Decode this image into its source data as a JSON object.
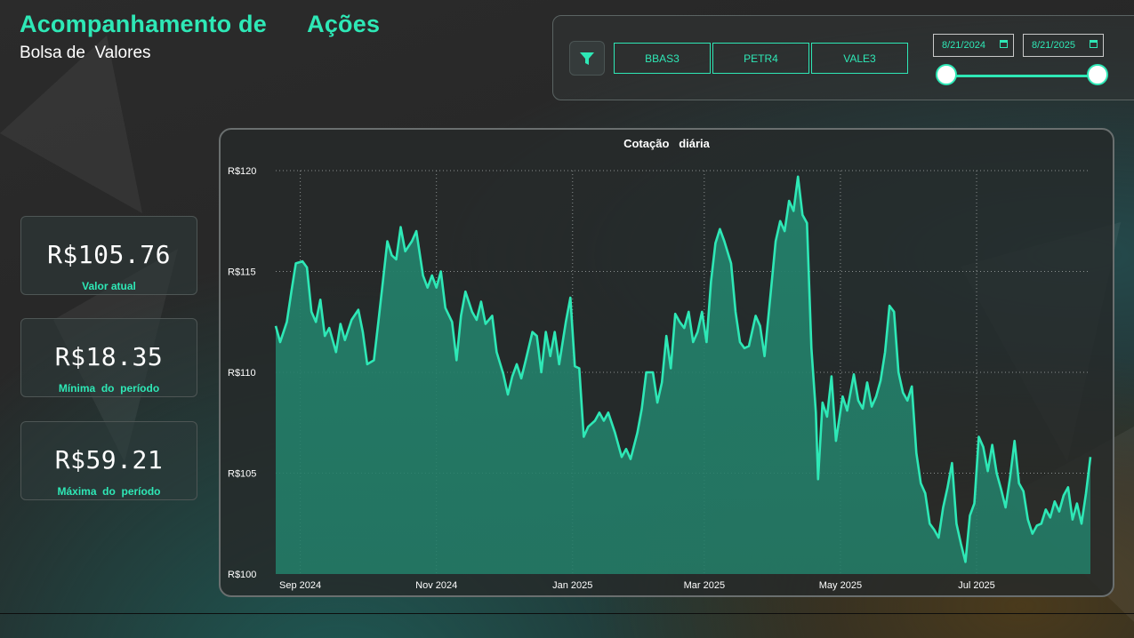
{
  "header": {
    "title": "Acompanhamento de      Ações",
    "subtitle": "Bolsa de  Valores"
  },
  "filters": {
    "icon": "filter-icon",
    "tickers": [
      "BBAS3",
      "PETR4",
      "VALE3"
    ],
    "date_start": "8/21/2024",
    "date_end": "8/21/2025",
    "range_fraction": [
      0,
      1
    ]
  },
  "kpis": [
    {
      "value": "R$105.76",
      "label": "Valor atual"
    },
    {
      "value": "R$18.35",
      "label": "Mínima  do  período"
    },
    {
      "value": "R$59.21",
      "label": "Máxima  do  período"
    }
  ],
  "colors": {
    "accent": "#2ee8b6",
    "area_fill": "#23806a",
    "background": "#262626"
  },
  "chart_data": {
    "type": "area",
    "title": "Cotação   diária",
    "xlabel": "",
    "ylabel": "",
    "ylim": [
      100,
      120
    ],
    "xlim": [
      "2024-08-21",
      "2025-08-21"
    ],
    "y_ticks": [
      "R$100",
      "R$105",
      "R$110",
      "R$115",
      "R$120"
    ],
    "x_ticks": [
      "Sep 2024",
      "Nov 2024",
      "Jan 2025",
      "Mar 2025",
      "May 2025",
      "Jul 2025"
    ],
    "x_tick_dates": [
      "2024-09-01",
      "2024-11-01",
      "2025-01-01",
      "2025-03-01",
      "2025-05-01",
      "2025-07-01"
    ],
    "grid": true,
    "series": [
      {
        "color": "#2ee8b6",
        "points": [
          [
            "2024-08-21",
            112.3
          ],
          [
            "2024-08-23",
            111.5
          ],
          [
            "2024-08-26",
            112.5
          ],
          [
            "2024-08-28",
            114.0
          ],
          [
            "2024-08-30",
            115.4
          ],
          [
            "2024-09-02",
            115.5
          ],
          [
            "2024-09-04",
            115.2
          ],
          [
            "2024-09-06",
            113.0
          ],
          [
            "2024-09-08",
            112.5
          ],
          [
            "2024-09-10",
            113.6
          ],
          [
            "2024-09-12",
            111.8
          ],
          [
            "2024-09-14",
            112.2
          ],
          [
            "2024-09-17",
            111.0
          ],
          [
            "2024-09-19",
            112.4
          ],
          [
            "2024-09-21",
            111.6
          ],
          [
            "2024-09-24",
            112.6
          ],
          [
            "2024-09-27",
            113.1
          ],
          [
            "2024-09-29",
            112.0
          ],
          [
            "2024-10-01",
            110.4
          ],
          [
            "2024-10-04",
            110.6
          ],
          [
            "2024-10-06",
            112.5
          ],
          [
            "2024-10-08",
            114.5
          ],
          [
            "2024-10-10",
            116.5
          ],
          [
            "2024-10-12",
            115.8
          ],
          [
            "2024-10-14",
            115.6
          ],
          [
            "2024-10-16",
            117.2
          ],
          [
            "2024-10-18",
            116.0
          ],
          [
            "2024-10-21",
            116.5
          ],
          [
            "2024-10-23",
            117.0
          ],
          [
            "2024-10-26",
            114.8
          ],
          [
            "2024-10-28",
            114.2
          ],
          [
            "2024-10-30",
            114.8
          ],
          [
            "2024-11-01",
            114.2
          ],
          [
            "2024-11-03",
            115.0
          ],
          [
            "2024-11-05",
            113.2
          ],
          [
            "2024-11-08",
            112.5
          ],
          [
            "2024-11-10",
            110.6
          ],
          [
            "2024-11-12",
            112.8
          ],
          [
            "2024-11-14",
            114.0
          ],
          [
            "2024-11-17",
            113.0
          ],
          [
            "2024-11-19",
            112.6
          ],
          [
            "2024-11-21",
            113.5
          ],
          [
            "2024-11-23",
            112.4
          ],
          [
            "2024-11-26",
            112.8
          ],
          [
            "2024-11-28",
            111.0
          ],
          [
            "2024-12-01",
            109.9
          ],
          [
            "2024-12-03",
            108.9
          ],
          [
            "2024-12-05",
            109.8
          ],
          [
            "2024-12-07",
            110.4
          ],
          [
            "2024-12-09",
            109.7
          ],
          [
            "2024-12-11",
            110.6
          ],
          [
            "2024-12-14",
            112.0
          ],
          [
            "2024-12-16",
            111.8
          ],
          [
            "2024-12-18",
            110.0
          ],
          [
            "2024-12-20",
            112.0
          ],
          [
            "2024-12-22",
            110.8
          ],
          [
            "2024-12-24",
            112.0
          ],
          [
            "2024-12-26",
            110.4
          ],
          [
            "2024-12-29",
            112.5
          ],
          [
            "2024-12-31",
            113.7
          ],
          [
            "2025-01-02",
            110.3
          ],
          [
            "2025-01-04",
            110.2
          ],
          [
            "2025-01-06",
            106.8
          ],
          [
            "2025-01-08",
            107.3
          ],
          [
            "2025-01-11",
            107.6
          ],
          [
            "2025-01-13",
            108.0
          ],
          [
            "2025-01-15",
            107.6
          ],
          [
            "2025-01-17",
            108.0
          ],
          [
            "2025-01-20",
            107.0
          ],
          [
            "2025-01-23",
            105.8
          ],
          [
            "2025-01-25",
            106.2
          ],
          [
            "2025-01-27",
            105.7
          ],
          [
            "2025-01-30",
            107.0
          ],
          [
            "2025-02-01",
            108.2
          ],
          [
            "2025-02-03",
            110.0
          ],
          [
            "2025-02-06",
            110.0
          ],
          [
            "2025-02-08",
            108.5
          ],
          [
            "2025-02-10",
            109.5
          ],
          [
            "2025-02-12",
            111.8
          ],
          [
            "2025-02-14",
            110.2
          ],
          [
            "2025-02-16",
            112.9
          ],
          [
            "2025-02-18",
            112.5
          ],
          [
            "2025-02-20",
            112.2
          ],
          [
            "2025-02-22",
            113.0
          ],
          [
            "2025-02-24",
            111.5
          ],
          [
            "2025-02-26",
            112.0
          ],
          [
            "2025-02-28",
            113.0
          ],
          [
            "2025-03-02",
            111.5
          ],
          [
            "2025-03-04",
            114.5
          ],
          [
            "2025-03-06",
            116.4
          ],
          [
            "2025-03-08",
            117.1
          ],
          [
            "2025-03-10",
            116.5
          ],
          [
            "2025-03-13",
            115.4
          ],
          [
            "2025-03-15",
            113.0
          ],
          [
            "2025-03-17",
            111.5
          ],
          [
            "2025-03-19",
            111.2
          ],
          [
            "2025-03-21",
            111.3
          ],
          [
            "2025-03-24",
            112.8
          ],
          [
            "2025-03-26",
            112.3
          ],
          [
            "2025-03-28",
            110.8
          ],
          [
            "2025-03-31",
            114.2
          ],
          [
            "2025-04-02",
            116.5
          ],
          [
            "2025-04-04",
            117.5
          ],
          [
            "2025-04-06",
            117.0
          ],
          [
            "2025-04-08",
            118.5
          ],
          [
            "2025-04-10",
            118.0
          ],
          [
            "2025-04-12",
            119.7
          ],
          [
            "2025-04-14",
            117.8
          ],
          [
            "2025-04-16",
            117.4
          ],
          [
            "2025-04-18",
            111.2
          ],
          [
            "2025-04-20",
            108.0
          ],
          [
            "2025-04-21",
            104.7
          ],
          [
            "2025-04-23",
            108.5
          ],
          [
            "2025-04-25",
            107.8
          ],
          [
            "2025-04-27",
            109.8
          ],
          [
            "2025-04-29",
            106.6
          ],
          [
            "2025-05-02",
            108.8
          ],
          [
            "2025-05-04",
            108.1
          ],
          [
            "2025-05-07",
            109.9
          ],
          [
            "2025-05-09",
            108.6
          ],
          [
            "2025-05-11",
            108.2
          ],
          [
            "2025-05-13",
            109.5
          ],
          [
            "2025-05-15",
            108.3
          ],
          [
            "2025-05-17",
            108.8
          ],
          [
            "2025-05-19",
            109.6
          ],
          [
            "2025-05-21",
            111.0
          ],
          [
            "2025-05-23",
            113.3
          ],
          [
            "2025-05-25",
            113.0
          ],
          [
            "2025-05-27",
            110.0
          ],
          [
            "2025-05-29",
            109.0
          ],
          [
            "2025-05-31",
            108.6
          ],
          [
            "2025-06-02",
            109.3
          ],
          [
            "2025-06-04",
            106.0
          ],
          [
            "2025-06-06",
            104.5
          ],
          [
            "2025-06-08",
            104.0
          ],
          [
            "2025-06-10",
            102.5
          ],
          [
            "2025-06-12",
            102.2
          ],
          [
            "2025-06-14",
            101.8
          ],
          [
            "2025-06-16",
            103.3
          ],
          [
            "2025-06-18",
            104.3
          ],
          [
            "2025-06-20",
            105.5
          ],
          [
            "2025-06-22",
            102.5
          ],
          [
            "2025-06-24",
            101.5
          ],
          [
            "2025-06-26",
            100.6
          ],
          [
            "2025-06-28",
            102.9
          ],
          [
            "2025-06-30",
            103.5
          ],
          [
            "2025-07-02",
            106.8
          ],
          [
            "2025-07-04",
            106.3
          ],
          [
            "2025-07-06",
            105.1
          ],
          [
            "2025-07-08",
            106.4
          ],
          [
            "2025-07-10",
            105.0
          ],
          [
            "2025-07-12",
            104.2
          ],
          [
            "2025-07-14",
            103.3
          ],
          [
            "2025-07-16",
            104.8
          ],
          [
            "2025-07-18",
            106.6
          ],
          [
            "2025-07-20",
            104.5
          ],
          [
            "2025-07-22",
            104.1
          ],
          [
            "2025-07-24",
            102.7
          ],
          [
            "2025-07-26",
            102.0
          ],
          [
            "2025-07-28",
            102.4
          ],
          [
            "2025-07-30",
            102.5
          ],
          [
            "2025-08-01",
            103.2
          ],
          [
            "2025-08-03",
            102.8
          ],
          [
            "2025-08-05",
            103.6
          ],
          [
            "2025-08-07",
            103.1
          ],
          [
            "2025-08-09",
            103.9
          ],
          [
            "2025-08-11",
            104.3
          ],
          [
            "2025-08-13",
            102.7
          ],
          [
            "2025-08-15",
            103.5
          ],
          [
            "2025-08-17",
            102.5
          ],
          [
            "2025-08-19",
            104.0
          ],
          [
            "2025-08-21",
            105.8
          ]
        ]
      }
    ]
  }
}
